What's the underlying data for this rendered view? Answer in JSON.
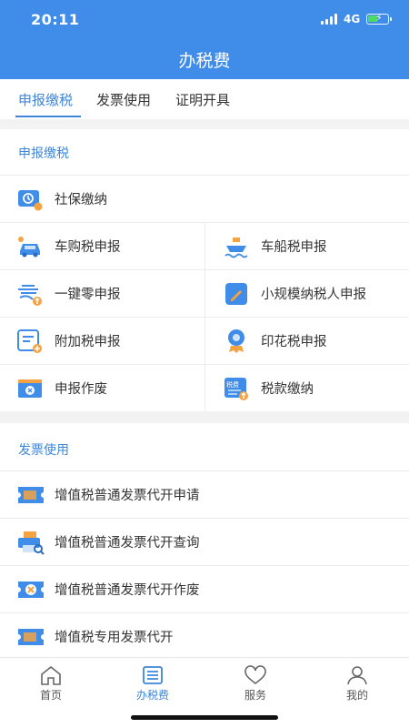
{
  "status_bar": {
    "time": "20:11",
    "network": "4G"
  },
  "header": {
    "title": "办税费"
  },
  "tabs": [
    {
      "label": "申报缴税",
      "active": true
    },
    {
      "label": "发票使用",
      "active": false
    },
    {
      "label": "证明开具",
      "active": false
    }
  ],
  "declare": {
    "title": "申报缴税",
    "items": [
      {
        "label": "社保缴纳",
        "icon": "social-security-icon"
      },
      {
        "label": "车购税申报",
        "icon": "car-icon"
      },
      {
        "label": "车船税申报",
        "icon": "ship-icon"
      },
      {
        "label": "一键零申报",
        "icon": "zero-icon"
      },
      {
        "label": "小规模纳税人申报",
        "icon": "document-pen-icon"
      },
      {
        "label": "附加税申报",
        "icon": "form-plus-icon"
      },
      {
        "label": "印花税申报",
        "icon": "stamp-icon"
      },
      {
        "label": "申报作废",
        "icon": "void-icon"
      },
      {
        "label": "税款缴纳",
        "icon": "tax-payment-icon"
      }
    ]
  },
  "invoice": {
    "title": "发票使用",
    "items": [
      {
        "label": "增值税普通发票代开申请",
        "icon": "invoice-icon"
      },
      {
        "label": "增值税普通发票代开查询",
        "icon": "printer-search-icon"
      },
      {
        "label": "增值税普通发票代开作废",
        "icon": "invoice-void-icon"
      },
      {
        "label": "增值税专用发票代开",
        "icon": "invoice-icon"
      }
    ]
  },
  "bottom_nav": [
    {
      "label": "首页",
      "icon": "home-icon",
      "active": false
    },
    {
      "label": "办税费",
      "icon": "list-icon",
      "active": true
    },
    {
      "label": "服务",
      "icon": "heart-icon",
      "active": false
    },
    {
      "label": "我的",
      "icon": "user-icon",
      "active": false
    }
  ],
  "colors": {
    "header": "#3f8ce9",
    "accent": "#3d86d8",
    "icon_orange": "#f5a243"
  }
}
